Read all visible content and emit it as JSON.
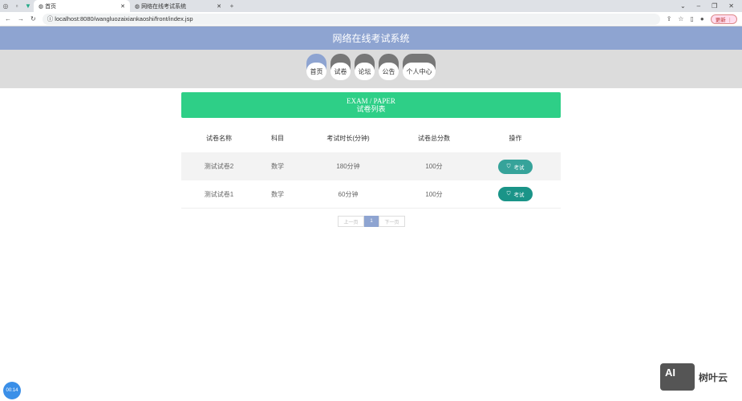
{
  "browser": {
    "tabs": [
      {
        "label": "首页",
        "active": true
      },
      {
        "label": "网络在线考试系统",
        "active": false
      }
    ],
    "url": "localhost:8080/wangluozaixiankaoshi/front/index.jsp",
    "update_label": "更新"
  },
  "header": {
    "title": "网络在线考试系统"
  },
  "nav": [
    {
      "label": "首页"
    },
    {
      "label": "试卷"
    },
    {
      "label": "论坛"
    },
    {
      "label": "公告"
    },
    {
      "label": "个人中心"
    }
  ],
  "banner": {
    "en": "EXAM / PAPER",
    "cn": "试卷列表"
  },
  "table": {
    "headers": [
      "试卷名称",
      "科目",
      "考试时长(分钟)",
      "试卷总分数",
      "操作"
    ],
    "rows": [
      [
        "测试试卷2",
        "数学",
        "180分钟",
        "100分",
        "考试"
      ],
      [
        "测试试卷1",
        "数学",
        "60分钟",
        "100分",
        "考试"
      ]
    ]
  },
  "pager": {
    "prev": "上一页",
    "current": "1",
    "next": "下一页"
  },
  "timer": "00:14",
  "watermark": "AI 树叶云",
  "colors": {
    "header": "#8ea4d1",
    "banner": "#2ecf87",
    "button": "#1a9488"
  }
}
